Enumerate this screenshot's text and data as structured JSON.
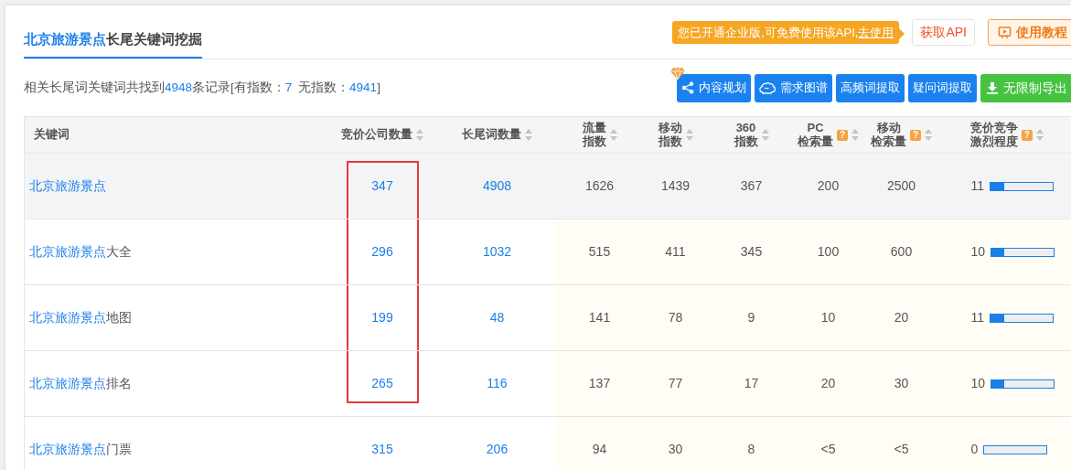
{
  "tab": {
    "highlight": "北京旅游景点",
    "rest": "长尾关键词挖掘",
    "selected": true
  },
  "notice": {
    "text": "您已开通企业版,可免费使用该API,",
    "link": "去使用"
  },
  "top_buttons": [
    {
      "kind": "plain",
      "label": "获取API"
    },
    {
      "kind": "tutorial",
      "label": "使用教程"
    }
  ],
  "summary": {
    "prefix": "相关长尾词关键词共找到",
    "total": "4948",
    "middle": "条记录[有指数：",
    "indexed": "7",
    "middle2": "无指数：",
    "unindexed": "4941",
    "suffix": "]"
  },
  "actions": [
    {
      "kind": "plan",
      "label": "内容规划"
    },
    {
      "kind": "graph",
      "label": "需求图谱"
    },
    {
      "kind": "plain",
      "label": "高频词提取"
    },
    {
      "kind": "plain",
      "label": "疑问词提取"
    },
    {
      "kind": "export",
      "label": "无限制导出"
    }
  ],
  "columns": [
    {
      "lines": [
        "关键词"
      ],
      "sortable": false
    },
    {
      "lines": [
        "竞价公司数量"
      ],
      "sortable": true
    },
    {
      "lines": [
        "长尾词数量"
      ],
      "sortable": true
    },
    {
      "lines": [
        "流量",
        "指数"
      ],
      "sortable": true
    },
    {
      "lines": [
        "移动",
        "指数"
      ],
      "sortable": true
    },
    {
      "lines": [
        "360",
        "指数"
      ],
      "sortable": true
    },
    {
      "lines": [
        "PC",
        "检索量"
      ],
      "sortable": true,
      "help": "?"
    },
    {
      "lines": [
        "移动",
        "检索量"
      ],
      "sortable": true,
      "help": "?"
    },
    {
      "lines": [
        "竞价竞争",
        "激烈程度"
      ],
      "sortable": true,
      "help": "?"
    }
  ],
  "rows": [
    {
      "hovered": true,
      "highlighted": true,
      "keyword": {
        "base": "北京旅游景点"
      },
      "bid": "347",
      "longtail": "4908",
      "cells": [
        "1626",
        "1439",
        "367",
        "200",
        "2500"
      ],
      "competition": {
        "reading": "11",
        "level": 0.22
      }
    },
    {
      "hovered": false,
      "highlighted": true,
      "keyword": {
        "base": "北京旅游景点",
        "suffix": "大全"
      },
      "bid": "296",
      "longtail": "1032",
      "cells": [
        "515",
        "411",
        "345",
        "100",
        "600"
      ],
      "competition": {
        "reading": "10",
        "level": 0.2
      }
    },
    {
      "hovered": false,
      "highlighted": true,
      "keyword": {
        "base": "北京旅游景点",
        "suffix": "地图"
      },
      "bid": "199",
      "longtail": "48",
      "cells": [
        "141",
        "78",
        "9",
        "10",
        "20"
      ],
      "competition": {
        "reading": "11",
        "level": 0.22
      }
    },
    {
      "hovered": false,
      "highlighted": true,
      "keyword": {
        "base": "北京旅游景点",
        "suffix": "排名"
      },
      "bid": "265",
      "longtail": "116",
      "cells": [
        "137",
        "77",
        "17",
        "20",
        "30"
      ],
      "competition": {
        "reading": "10",
        "level": 0.2
      }
    },
    {
      "hovered": false,
      "highlighted": false,
      "keyword": {
        "base": "北京旅游景点",
        "suffix": "门票"
      },
      "bid": "315",
      "longtail": "206",
      "cells": [
        "94",
        "30",
        "8",
        "<5",
        "<5"
      ],
      "competition": {
        "reading": "0",
        "level": 0
      }
    }
  ]
}
